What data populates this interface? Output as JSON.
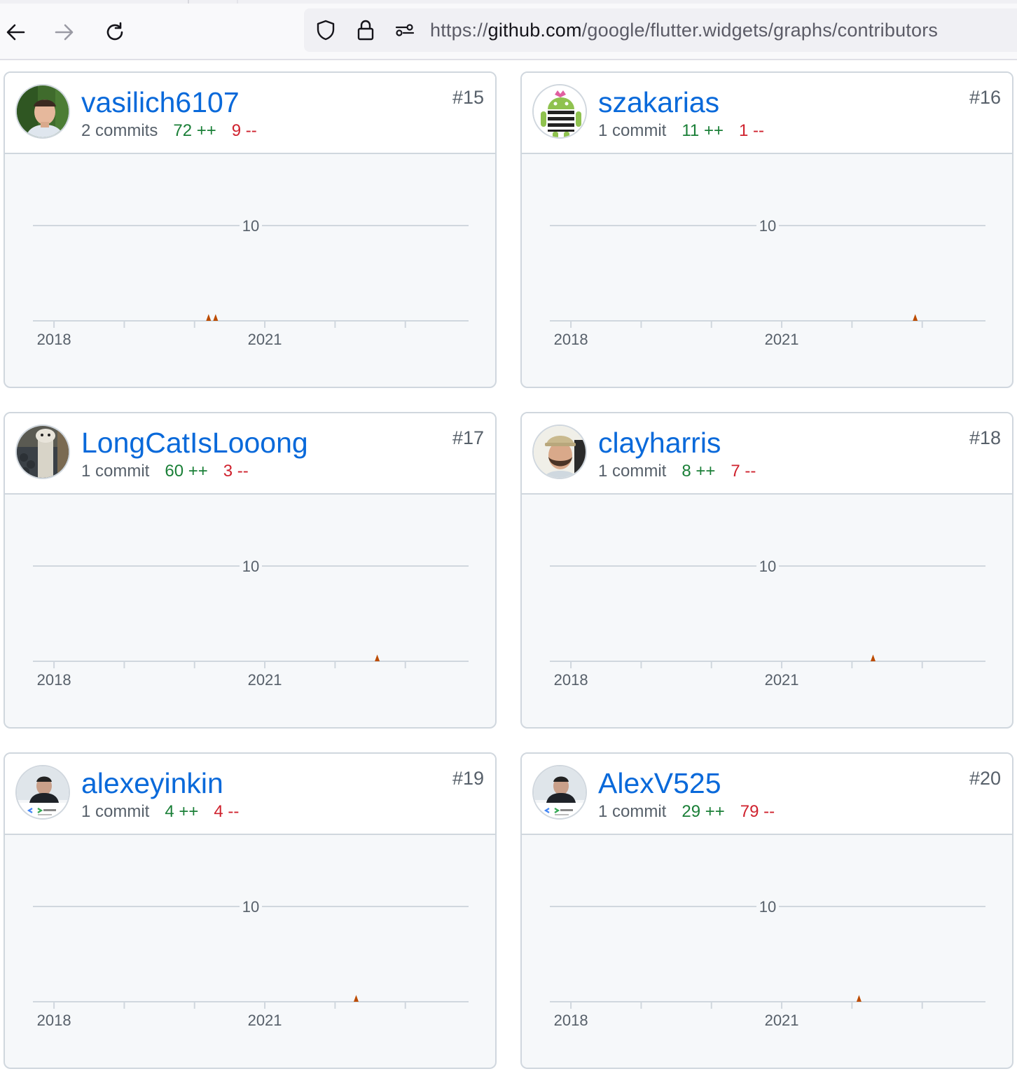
{
  "browser": {
    "url_scheme": "https://",
    "url_host": "github.com",
    "url_path": "/google/flutter.widgets/graphs/contributors"
  },
  "cards": [
    {
      "login": "vasilich6107",
      "rank": "#15",
      "commits": "2 commits",
      "additions": "72 ++",
      "deletions": "9 --",
      "avatar": "person-photo-avatar"
    },
    {
      "login": "szakarias",
      "rank": "#16",
      "commits": "1 commit",
      "additions": "11 ++",
      "deletions": "1 --",
      "avatar": "android-robot-avatar"
    },
    {
      "login": "LongCatIsLooong",
      "rank": "#17",
      "commits": "1 commit",
      "additions": "60 ++",
      "deletions": "3 --",
      "avatar": "longcat-avatar"
    },
    {
      "login": "clayharris",
      "rank": "#18",
      "commits": "1 commit",
      "additions": "8 ++",
      "deletions": "7 --",
      "avatar": "bearded-man-avatar"
    },
    {
      "login": "alexeyinkin",
      "rank": "#19",
      "commits": "1 commit",
      "additions": "4 ++",
      "deletions": "4 --",
      "avatar": "experts-badge-avatar"
    },
    {
      "login": "AlexV525",
      "rank": "#20",
      "commits": "1 commit",
      "additions": "29 ++",
      "deletions": "79 --",
      "avatar": "experts-badge-avatar"
    }
  ],
  "colors": {
    "link": "#0969da",
    "additions": "#1a7f37",
    "deletions": "#cf222e",
    "spike": "#bc4c00"
  },
  "chart_data": [
    {
      "type": "area",
      "title": "vasilich6107",
      "ylim": [
        0,
        10
      ],
      "y_ticks": [
        10
      ],
      "x_ticks": [
        "2018",
        "2021"
      ],
      "x_range": [
        2017.7,
        2023.9
      ],
      "series": [
        {
          "x": [
            2020.2,
            2020.3
          ],
          "y": [
            1,
            1
          ]
        }
      ]
    },
    {
      "type": "area",
      "title": "szakarias",
      "ylim": [
        0,
        10
      ],
      "y_ticks": [
        10
      ],
      "x_ticks": [
        "2018",
        "2021"
      ],
      "x_range": [
        2017.7,
        2023.9
      ],
      "series": [
        {
          "x": [
            2022.9
          ],
          "y": [
            1
          ]
        }
      ]
    },
    {
      "type": "area",
      "title": "LongCatIsLooong",
      "ylim": [
        0,
        10
      ],
      "y_ticks": [
        10
      ],
      "x_ticks": [
        "2018",
        "2021"
      ],
      "x_range": [
        2017.7,
        2023.9
      ],
      "series": [
        {
          "x": [
            2022.6
          ],
          "y": [
            1
          ]
        }
      ]
    },
    {
      "type": "area",
      "title": "clayharris",
      "ylim": [
        0,
        10
      ],
      "y_ticks": [
        10
      ],
      "x_ticks": [
        "2018",
        "2021"
      ],
      "x_range": [
        2017.7,
        2023.9
      ],
      "series": [
        {
          "x": [
            2022.3
          ],
          "y": [
            1
          ]
        }
      ]
    },
    {
      "type": "area",
      "title": "alexeyinkin",
      "ylim": [
        0,
        10
      ],
      "y_ticks": [
        10
      ],
      "x_ticks": [
        "2018",
        "2021"
      ],
      "x_range": [
        2017.7,
        2023.9
      ],
      "series": [
        {
          "x": [
            2022.3
          ],
          "y": [
            1
          ]
        }
      ]
    },
    {
      "type": "area",
      "title": "AlexV525",
      "ylim": [
        0,
        10
      ],
      "y_ticks": [
        10
      ],
      "x_ticks": [
        "2018",
        "2021"
      ],
      "x_range": [
        2017.7,
        2023.9
      ],
      "series": [
        {
          "x": [
            2022.1
          ],
          "y": [
            1
          ]
        }
      ]
    }
  ]
}
